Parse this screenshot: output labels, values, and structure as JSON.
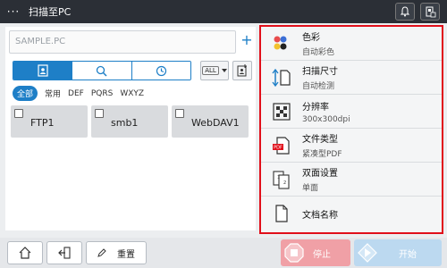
{
  "app": {
    "title": "扫描至PC"
  },
  "topbar": {
    "menu_label": "···"
  },
  "left": {
    "destination_placeholder": "SAMPLE.PC",
    "add_label": "+",
    "all_label": "ALL",
    "alpha_tabs": [
      "全部",
      "常用",
      "DEF",
      "PQRS",
      "WXYZ"
    ],
    "destinations": [
      "FTP1",
      "smb1",
      "WebDAV1"
    ]
  },
  "settings": {
    "color": {
      "title": "色彩",
      "value": "自动彩色"
    },
    "scan_size": {
      "title": "扫描尺寸",
      "value": "自动检测"
    },
    "resolution": {
      "title": "分辨率",
      "value": "300x300dpi"
    },
    "file_type": {
      "title": "文件类型",
      "value": "紧凑型PDF"
    },
    "duplex": {
      "title": "双面设置",
      "value": "单面"
    },
    "doc_name": {
      "title": "文档名称",
      "value": ""
    }
  },
  "bottombar": {
    "reset_label": "重置",
    "stop_label": "停止",
    "start_label": "开始"
  },
  "colors": {
    "accent": "#1e7fc7",
    "highlight_border": "#e10f1a",
    "stop": "#f0a0a6",
    "start": "#bcd9f0"
  }
}
